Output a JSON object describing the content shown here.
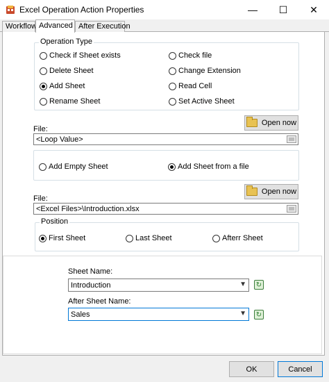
{
  "window": {
    "title": "Excel Operation Action Properties",
    "controls": {
      "minimize": "—",
      "maximize": "☐",
      "close": "✕"
    }
  },
  "tabs": [
    {
      "label": "Workflow",
      "selected": false
    },
    {
      "label": "Advanced",
      "selected": true
    },
    {
      "label": "After Execution",
      "selected": false
    }
  ],
  "operation_type": {
    "label": "Operation Type",
    "options": [
      {
        "label": "Check if Sheet exists",
        "selected": false
      },
      {
        "label": "Delete Sheet",
        "selected": false
      },
      {
        "label": "Add Sheet",
        "selected": true
      },
      {
        "label": "Rename Sheet",
        "selected": false
      },
      {
        "label": "Check file",
        "selected": false
      },
      {
        "label": "Change Extension",
        "selected": false
      },
      {
        "label": "Read Cell",
        "selected": false
      },
      {
        "label": "Set Active Sheet",
        "selected": false
      }
    ]
  },
  "file1": {
    "label": "File:",
    "value": "<Loop Value>",
    "open_label": "Open now"
  },
  "add_mode": {
    "options": [
      {
        "label": "Add Empty Sheet",
        "selected": false
      },
      {
        "label": "Add Sheet from a file",
        "selected": true
      }
    ]
  },
  "file2": {
    "label": "File:",
    "value": "<Excel Files>\\Introduction.xlsx",
    "open_label": "Open now"
  },
  "position": {
    "label": "Position",
    "options": [
      {
        "label": "First Sheet",
        "selected": true
      },
      {
        "label": "Last Sheet",
        "selected": false
      },
      {
        "label": "Afterr Sheet",
        "selected": false
      }
    ]
  },
  "sheet_name": {
    "label": "Sheet Name:",
    "value": "Introduction"
  },
  "after_sheet_name": {
    "label": "After Sheet Name:",
    "value": "Sales"
  },
  "footer": {
    "ok_label": "OK",
    "cancel_label": "Cancel"
  },
  "colors": {
    "accent": "#0078d7",
    "button_face": "#e1e1e1",
    "window_bg": "#f0f0f0"
  }
}
